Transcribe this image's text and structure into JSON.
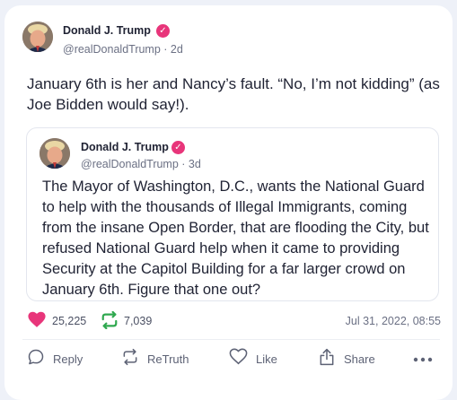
{
  "post": {
    "author_name": "Donald J. Trump",
    "handle": "@realDonaldTrump",
    "age": "2d",
    "text": "January 6th is her and Nancy’s fault. “No, I’m not kidding” (as Joe Bidden would say!).",
    "quote": {
      "author_name": "Donald J. Trump",
      "handle": "@realDonaldTrump",
      "age": "3d",
      "text": "The Mayor of Washington, D.C., wants the National Guard to help with the thousands of Illegal Immigrants, coming from the insane Open Border, that are flooding the City, but refused National Guard help when it came to providing Security at the Capitol Building for a far larger crowd on January 6th. Figure that one out?"
    },
    "stats": {
      "likes": "25,225",
      "retruths": "7,039",
      "timestamp": "Jul 31, 2022, 08:55"
    },
    "actions": {
      "reply": "Reply",
      "retruth": "ReTruth",
      "like": "Like",
      "share": "Share"
    }
  },
  "colors": {
    "accent": "#e8357a",
    "retruth": "#2fa84f",
    "text": "#1f2233",
    "muted": "#6b7084"
  },
  "icons": {
    "verified": "verified-badge-icon",
    "like": "heart-icon",
    "retruth": "retruth-arrows-icon",
    "reply": "speech-bubble-icon",
    "share": "share-upload-icon",
    "more": "ellipsis-icon"
  }
}
